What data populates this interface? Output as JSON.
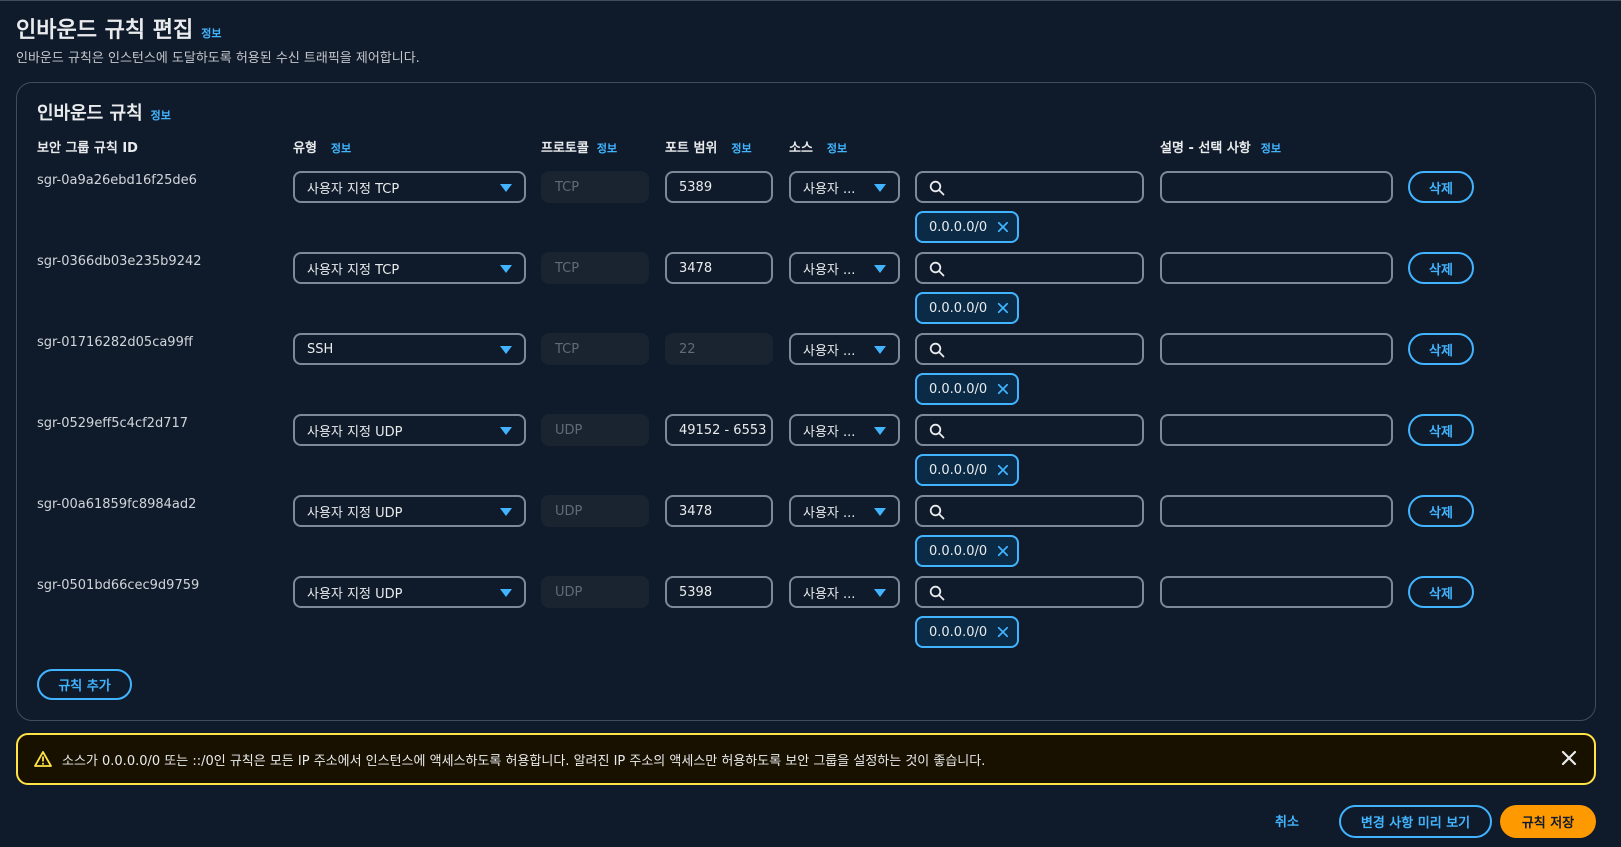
{
  "page": {
    "title": "인바운드 규칙 편집",
    "info": "정보",
    "description": "인바운드 규칙은 인스턴스에 도달하도록 허용된 수신 트래픽을 제어합니다."
  },
  "panel": {
    "title": "인바운드 규칙",
    "info": "정보",
    "columns": {
      "rule_id": "보안 그룹 규칙 ID",
      "type": "유형",
      "protocol": "프로토콜",
      "port": "포트 범위",
      "source": "소스",
      "description": "설명 - 선택 사항",
      "info": "정보"
    },
    "rows": [
      {
        "id": "sgr-0a9a26ebd16f25de6",
        "type": "사용자 지정 TCP",
        "protocol": "TCP",
        "port": "5389",
        "port_disabled": false,
        "source": "사용자 ...",
        "search_placeholder": "",
        "token": "0.0.0.0/0",
        "description": "",
        "delete": "삭제"
      },
      {
        "id": "sgr-0366db03e235b9242",
        "type": "사용자 지정 TCP",
        "protocol": "TCP",
        "port": "3478",
        "port_disabled": false,
        "source": "사용자 ...",
        "search_placeholder": "",
        "token": "0.0.0.0/0",
        "description": "",
        "delete": "삭제"
      },
      {
        "id": "sgr-01716282d05ca99ff",
        "type": "SSH",
        "protocol": "TCP",
        "port": "22",
        "port_disabled": true,
        "source": "사용자 ...",
        "search_placeholder": "",
        "token": "0.0.0.0/0",
        "description": "",
        "delete": "삭제"
      },
      {
        "id": "sgr-0529eff5c4cf2d717",
        "type": "사용자 지정 UDP",
        "protocol": "UDP",
        "port": "49152 - 6553",
        "port_disabled": false,
        "source": "사용자 ...",
        "search_placeholder": "",
        "token": "0.0.0.0/0",
        "description": "",
        "delete": "삭제"
      },
      {
        "id": "sgr-00a61859fc8984ad2",
        "type": "사용자 지정 UDP",
        "protocol": "UDP",
        "port": "3478",
        "port_disabled": false,
        "source": "사용자 ...",
        "search_placeholder": "",
        "token": "0.0.0.0/0",
        "description": "",
        "delete": "삭제"
      },
      {
        "id": "sgr-0501bd66cec9d9759",
        "type": "사용자 지정 UDP",
        "protocol": "UDP",
        "port": "5398",
        "port_disabled": false,
        "source": "사용자 ...",
        "search_placeholder": "",
        "token": "0.0.0.0/0",
        "description": "",
        "delete": "삭제"
      }
    ],
    "add_rule": "규칙 추가"
  },
  "alert": {
    "message": "소스가 0.0.0.0/0 또는 ::/0인 규칙은 모든 IP 주소에서 인스턴스에 액세스하도록 허용합니다. 알려진 IP 주소의 액세스만 허용하도록 보안 그룹을 설정하는 것이 좋습니다.",
    "icon": "warning-icon"
  },
  "footer": {
    "cancel": "취소",
    "preview": "변경 사항 미리 보기",
    "save": "규칙 저장"
  },
  "colors": {
    "accent": "#42b4ff",
    "primary_button": "#ff9900",
    "warning_border": "#ffe347",
    "background": "#0f1b2a"
  }
}
